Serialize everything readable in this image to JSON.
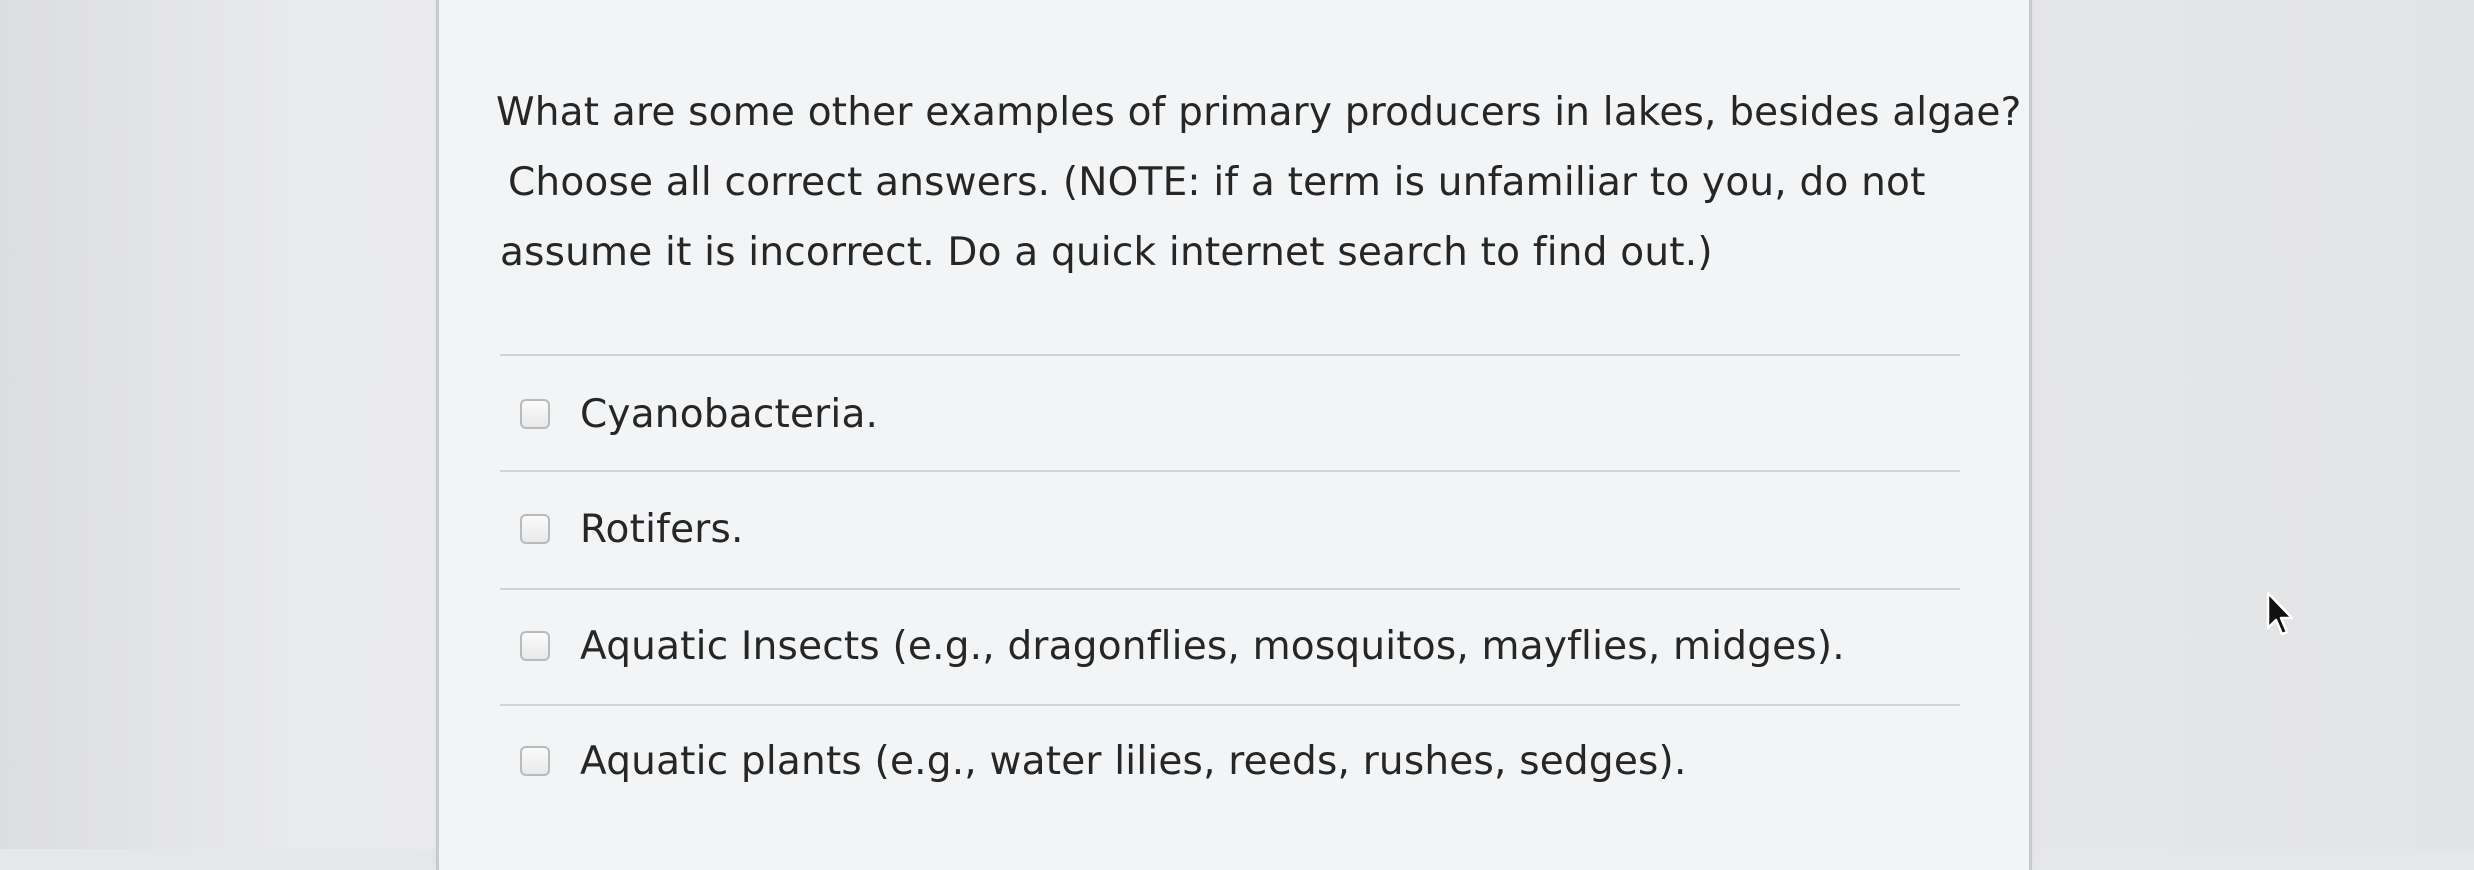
{
  "question": {
    "lines": [
      "What are some other examples of primary producers in lakes, besides algae?",
      " Choose all correct answers.  (NOTE: if a term is unfamiliar to you, do not",
      "assume it is incorrect.  Do a quick internet search to find out.)"
    ]
  },
  "options": [
    {
      "label": "Cyanobacteria.",
      "checked": false
    },
    {
      "label": "Rotifers.",
      "checked": false
    },
    {
      "label": "Aquatic Insects (e.g., dragonflies, mosquitos, mayflies, midges).",
      "checked": false
    },
    {
      "label": "Aquatic plants (e.g., water lilies, reeds, rushes, sedges).",
      "checked": false
    }
  ],
  "colors": {
    "text": "#262626",
    "panel": "#f3f4f5",
    "rule": "#d2d3d5",
    "checkbox_border": "#b9babc"
  },
  "icons": {
    "pointer": "mouse-pointer-icon"
  }
}
